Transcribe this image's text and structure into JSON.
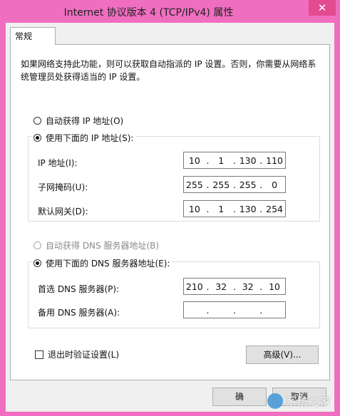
{
  "window": {
    "title": "Internet 协议版本 4 (TCP/IPv4) 属性",
    "close_glyph": "✕"
  },
  "tab": {
    "label": "常规"
  },
  "intro": "如果网络支持此功能，则可以获取自动指派的 IP 设置。否则，你需要从网络系统管理员处获得适当的 IP 设置。",
  "ip": {
    "auto_label": "自动获得 IP 地址(O)",
    "manual_label": "使用下面的 IP 地址(S):",
    "selected": "manual",
    "fields": [
      {
        "label": "IP 地址(I):",
        "octets": [
          "10",
          "1",
          "130",
          "110"
        ]
      },
      {
        "label": "子网掩码(U):",
        "octets": [
          "255",
          "255",
          "255",
          "0"
        ]
      },
      {
        "label": "默认网关(D):",
        "octets": [
          "10",
          "1",
          "130",
          "254"
        ]
      }
    ]
  },
  "dns": {
    "auto_label": "自动获得 DNS 服务器地址(B)",
    "manual_label": "使用下面的 DNS 服务器地址(E):",
    "selected": "manual",
    "fields": [
      {
        "label": "首选 DNS 服务器(P):",
        "octets": [
          "210",
          "32",
          "32",
          "10"
        ]
      },
      {
        "label": "备用 DNS 服务器(A):",
        "octets": [
          "",
          "",
          "",
          ""
        ]
      }
    ]
  },
  "validate_label": "退出时验证设置(L)",
  "advanced_label": "高级(V)...",
  "ok_label": "确",
  "cancel_label": "取消",
  "watermark": "系统之家"
}
